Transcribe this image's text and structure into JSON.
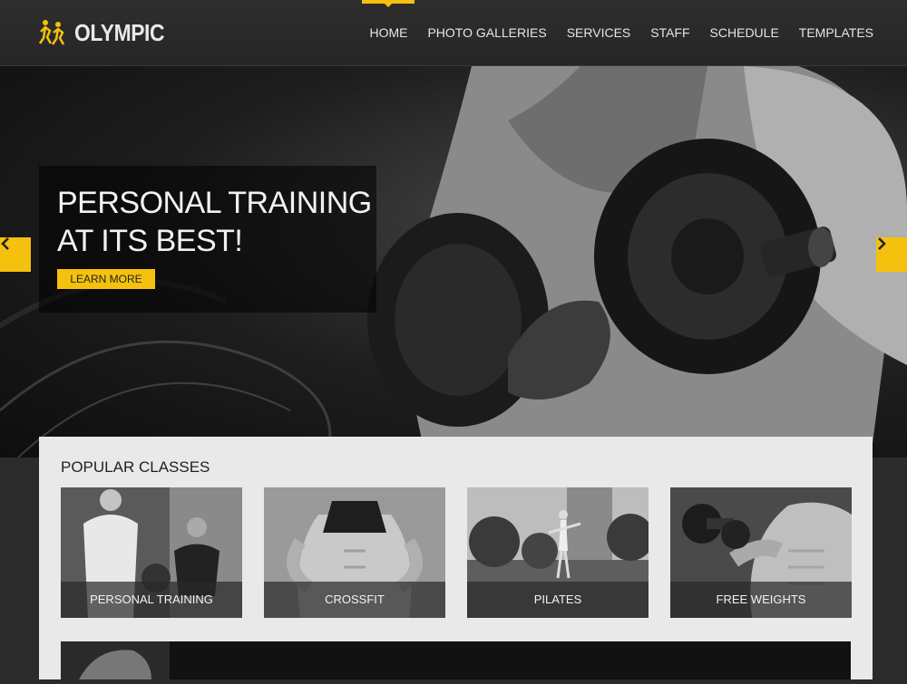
{
  "header": {
    "brand": "OLYMPIC",
    "nav": [
      {
        "label": "HOME",
        "active": true
      },
      {
        "label": "PHOTO GALLERIES"
      },
      {
        "label": "SERVICES"
      },
      {
        "label": "STAFF"
      },
      {
        "label": "SCHEDULE"
      },
      {
        "label": "TEMPLATES"
      }
    ]
  },
  "hero": {
    "title_line1": "PERSONAL TRAINING",
    "title_line2": "AT ITS BEST!",
    "button": "LEARN MORE"
  },
  "classes": {
    "heading": "POPULAR CLASSES",
    "items": [
      {
        "label": "PERSONAL TRAINING"
      },
      {
        "label": "CROSSFIT"
      },
      {
        "label": "PILATES"
      },
      {
        "label": "FREE WEIGHTS"
      }
    ]
  },
  "colors": {
    "accent": "#f4c10f",
    "header_bg": "#2b2b2b",
    "panel_bg": "#e9e9e9"
  }
}
